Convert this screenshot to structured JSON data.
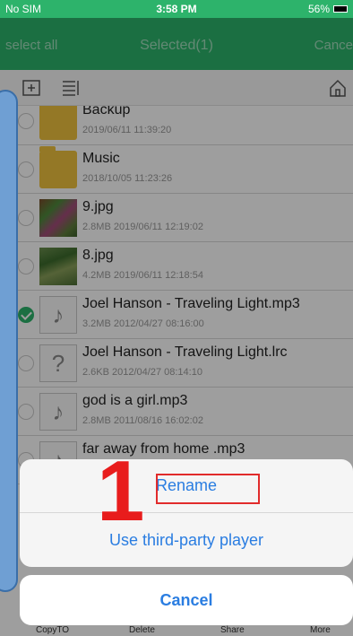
{
  "status": {
    "carrier": "No SIM",
    "time": "3:58 PM",
    "battery": "56%"
  },
  "nav": {
    "left": "select all",
    "title": "Selected(1)",
    "right": "Cance"
  },
  "toolbar": {
    "icons": [
      "add-folder-icon",
      "sort-icon",
      "home-icon"
    ]
  },
  "files": [
    {
      "name": "Backup",
      "meta": "2019/06/11 11:39:20",
      "type": "folder",
      "checked": false
    },
    {
      "name": "Music",
      "meta": "2018/10/05 11:23:26",
      "type": "folder",
      "checked": false
    },
    {
      "name": "9.jpg",
      "meta": "2.8MB 2019/06/11 12:19:02",
      "type": "photo",
      "checked": false
    },
    {
      "name": "8.jpg",
      "meta": "4.2MB 2019/06/11 12:18:54",
      "type": "photo",
      "checked": false
    },
    {
      "name": "Joel Hanson - Traveling Light.mp3",
      "meta": "3.2MB 2012/04/27 08:16:00",
      "type": "audio",
      "checked": true
    },
    {
      "name": "Joel Hanson - Traveling Light.lrc",
      "meta": "2.6KB 2012/04/27 08:14:10",
      "type": "unknown",
      "checked": false
    },
    {
      "name": "god is a girl.mp3",
      "meta": "2.8MB 2011/08/16 16:02:02",
      "type": "audio",
      "checked": false
    },
    {
      "name": "far away from home .mp3",
      "meta": "",
      "type": "audio",
      "checked": false
    }
  ],
  "sheet": {
    "option1": "Rename",
    "option2": "Use third-party player",
    "cancel": "Cancel"
  },
  "annotation": {
    "step": "1"
  },
  "bottom": {
    "copy": "CopyTO",
    "delete": "Delete",
    "share": "Share",
    "more": "More"
  },
  "colors": {
    "accent": "#2db36b",
    "link": "#2a7de1",
    "highlight": "#e12b2b"
  }
}
